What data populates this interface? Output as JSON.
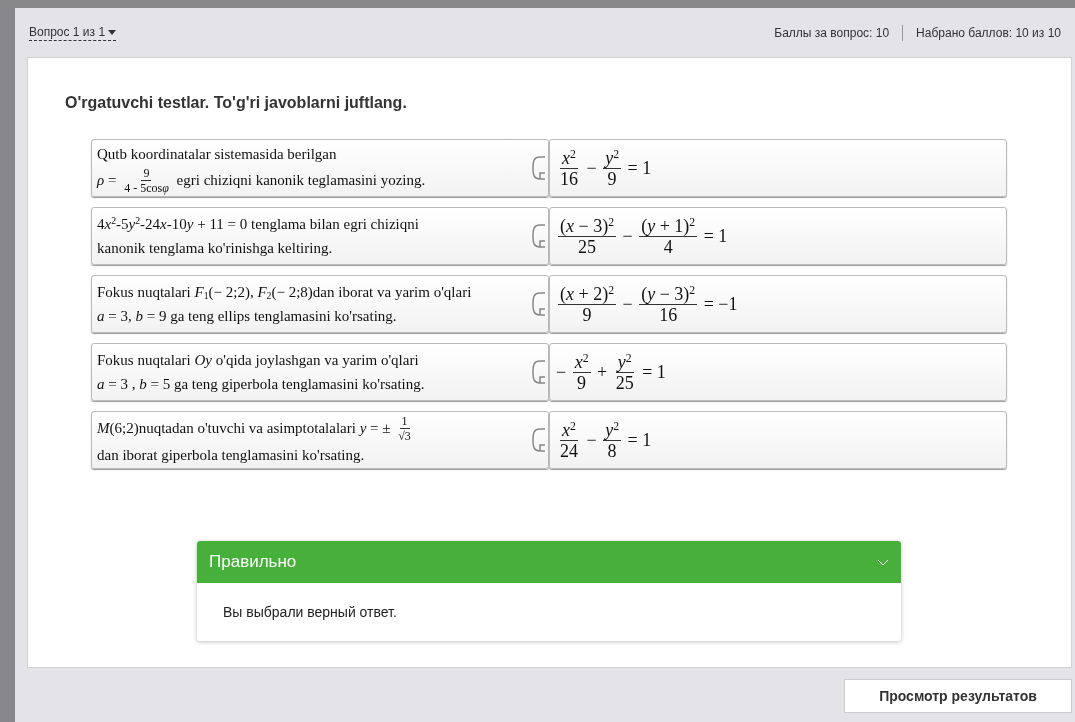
{
  "header": {
    "question_menu": "Вопрос 1 из 1",
    "points_per_question": "Баллы за вопрос: 10",
    "points_scored": "Набрано баллов: 10 из 10"
  },
  "question": {
    "title": "O'rgatuvchi testlar. To'g'ri javoblarni juftlang.",
    "pairs": [
      {
        "prompt": [
          [
            {
              "kind": "text",
              "text": "Qutb koordinatalar sistemasida berilgan"
            }
          ],
          [
            {
              "kind": "var",
              "text": "ρ"
            },
            {
              "kind": "text",
              "text": " = "
            },
            {
              "kind": "frac",
              "num": [
                {
                  "kind": "text",
                  "text": "9"
                }
              ],
              "den": [
                {
                  "kind": "text",
                  "text": "4 - 5cos"
                },
                {
                  "kind": "var",
                  "text": "φ"
                }
              ]
            },
            {
              "kind": "text",
              "text": " egri chiziqni kanonik teglamasini yozing."
            }
          ]
        ],
        "answer": [
          {
            "kind": "frac",
            "num": [
              {
                "kind": "var",
                "text": "x"
              },
              {
                "kind": "sup",
                "text": "2"
              }
            ],
            "den": [
              {
                "kind": "text",
                "text": "16"
              }
            ]
          },
          {
            "kind": "text",
            "text": " − "
          },
          {
            "kind": "frac",
            "num": [
              {
                "kind": "var",
                "text": "y"
              },
              {
                "kind": "sup",
                "text": "2"
              }
            ],
            "den": [
              {
                "kind": "text",
                "text": "9"
              }
            ]
          },
          {
            "kind": "text",
            "text": " = 1"
          }
        ]
      },
      {
        "prompt": [
          [
            {
              "kind": "text",
              "text": "4"
            },
            {
              "kind": "var",
              "text": "x"
            },
            {
              "kind": "sup",
              "text": "2"
            },
            {
              "kind": "text",
              "text": "-5"
            },
            {
              "kind": "var",
              "text": "y"
            },
            {
              "kind": "sup",
              "text": "2"
            },
            {
              "kind": "text",
              "text": "-24"
            },
            {
              "kind": "var",
              "text": "x"
            },
            {
              "kind": "text",
              "text": "-10"
            },
            {
              "kind": "var",
              "text": "y"
            },
            {
              "kind": "text",
              "text": " + 11 = 0 tenglama bilan egri chiziqni"
            }
          ],
          [
            {
              "kind": "text",
              "text": "kanonik tenglama ko'rinishga keltiring."
            }
          ]
        ],
        "answer": [
          {
            "kind": "frac",
            "num": [
              {
                "kind": "text",
                "text": "("
              },
              {
                "kind": "var",
                "text": "x"
              },
              {
                "kind": "text",
                "text": " − 3)"
              },
              {
                "kind": "sup",
                "text": "2"
              }
            ],
            "den": [
              {
                "kind": "text",
                "text": "25"
              }
            ]
          },
          {
            "kind": "text",
            "text": " − "
          },
          {
            "kind": "frac",
            "num": [
              {
                "kind": "text",
                "text": "("
              },
              {
                "kind": "var",
                "text": "y"
              },
              {
                "kind": "text",
                "text": " + 1)"
              },
              {
                "kind": "sup",
                "text": "2"
              }
            ],
            "den": [
              {
                "kind": "text",
                "text": "4"
              }
            ]
          },
          {
            "kind": "text",
            "text": " = 1"
          }
        ]
      },
      {
        "prompt": [
          [
            {
              "kind": "text",
              "text": "Fokus nuqtalari "
            },
            {
              "kind": "var",
              "text": "F"
            },
            {
              "kind": "sub",
              "text": "1"
            },
            {
              "kind": "text",
              "text": "(− 2;2), "
            },
            {
              "kind": "var",
              "text": "F"
            },
            {
              "kind": "sub",
              "text": "2"
            },
            {
              "kind": "text",
              "text": "(− 2;8)dan iborat va yarim o'qlari"
            }
          ],
          [
            {
              "kind": "var",
              "text": "a"
            },
            {
              "kind": "text",
              "text": " = 3, "
            },
            {
              "kind": "var",
              "text": "b"
            },
            {
              "kind": "text",
              "text": " = 9 ga teng ellips tenglamasini ko'rsating."
            }
          ]
        ],
        "answer": [
          {
            "kind": "frac",
            "num": [
              {
                "kind": "text",
                "text": "("
              },
              {
                "kind": "var",
                "text": "x"
              },
              {
                "kind": "text",
                "text": " + 2)"
              },
              {
                "kind": "sup",
                "text": "2"
              }
            ],
            "den": [
              {
                "kind": "text",
                "text": "9"
              }
            ]
          },
          {
            "kind": "text",
            "text": " − "
          },
          {
            "kind": "frac",
            "num": [
              {
                "kind": "text",
                "text": "("
              },
              {
                "kind": "var",
                "text": "y"
              },
              {
                "kind": "text",
                "text": " − 3)"
              },
              {
                "kind": "sup",
                "text": "2"
              }
            ],
            "den": [
              {
                "kind": "text",
                "text": "16"
              }
            ]
          },
          {
            "kind": "text",
            "text": " = −1"
          }
        ]
      },
      {
        "prompt": [
          [
            {
              "kind": "text",
              "text": "Fokus nuqtalari "
            },
            {
              "kind": "var",
              "text": "Oy"
            },
            {
              "kind": "text",
              "text": " o'qida joylashgan va yarim o'qlari"
            }
          ],
          [
            {
              "kind": "var",
              "text": "a"
            },
            {
              "kind": "text",
              "text": " = 3 , "
            },
            {
              "kind": "var",
              "text": "b"
            },
            {
              "kind": "text",
              "text": " = 5 ga teng giperbola tenglamasini ko'rsating."
            }
          ]
        ],
        "answer": [
          {
            "kind": "text",
            "text": "− "
          },
          {
            "kind": "frac",
            "num": [
              {
                "kind": "var",
                "text": "x"
              },
              {
                "kind": "sup",
                "text": "2"
              }
            ],
            "den": [
              {
                "kind": "text",
                "text": "9"
              }
            ]
          },
          {
            "kind": "text",
            "text": " + "
          },
          {
            "kind": "frac",
            "num": [
              {
                "kind": "var",
                "text": "y"
              },
              {
                "kind": "sup",
                "text": "2"
              }
            ],
            "den": [
              {
                "kind": "text",
                "text": "25"
              }
            ]
          },
          {
            "kind": "text",
            "text": " = 1"
          }
        ]
      },
      {
        "prompt": [
          [
            {
              "kind": "var",
              "text": "M"
            },
            {
              "kind": "text",
              "text": "(6;2)nuqtadan o'tuvchi va asimptotalalari "
            },
            {
              "kind": "var",
              "text": "y"
            },
            {
              "kind": "text",
              "text": " = ± "
            },
            {
              "kind": "frac",
              "num": [
                {
                  "kind": "text",
                  "text": "1"
                }
              ],
              "den": [
                {
                  "kind": "text",
                  "text": "√3"
                }
              ]
            }
          ],
          [
            {
              "kind": "text",
              "text": "dan iborat giperbola tenglamasini ko'rsating."
            }
          ]
        ],
        "answer": [
          {
            "kind": "frac",
            "num": [
              {
                "kind": "var",
                "text": "x"
              },
              {
                "kind": "sup",
                "text": "2"
              }
            ],
            "den": [
              {
                "kind": "text",
                "text": "24"
              }
            ]
          },
          {
            "kind": "text",
            "text": " − "
          },
          {
            "kind": "frac",
            "num": [
              {
                "kind": "var",
                "text": "y"
              },
              {
                "kind": "sup",
                "text": "2"
              }
            ],
            "den": [
              {
                "kind": "text",
                "text": "8"
              }
            ]
          },
          {
            "kind": "text",
            "text": " = 1"
          }
        ]
      }
    ]
  },
  "feedback": {
    "correct": true,
    "title": "Правильно",
    "expanded": true,
    "message": "Вы выбрали верный ответ."
  },
  "results_button": "Просмотр результатов"
}
